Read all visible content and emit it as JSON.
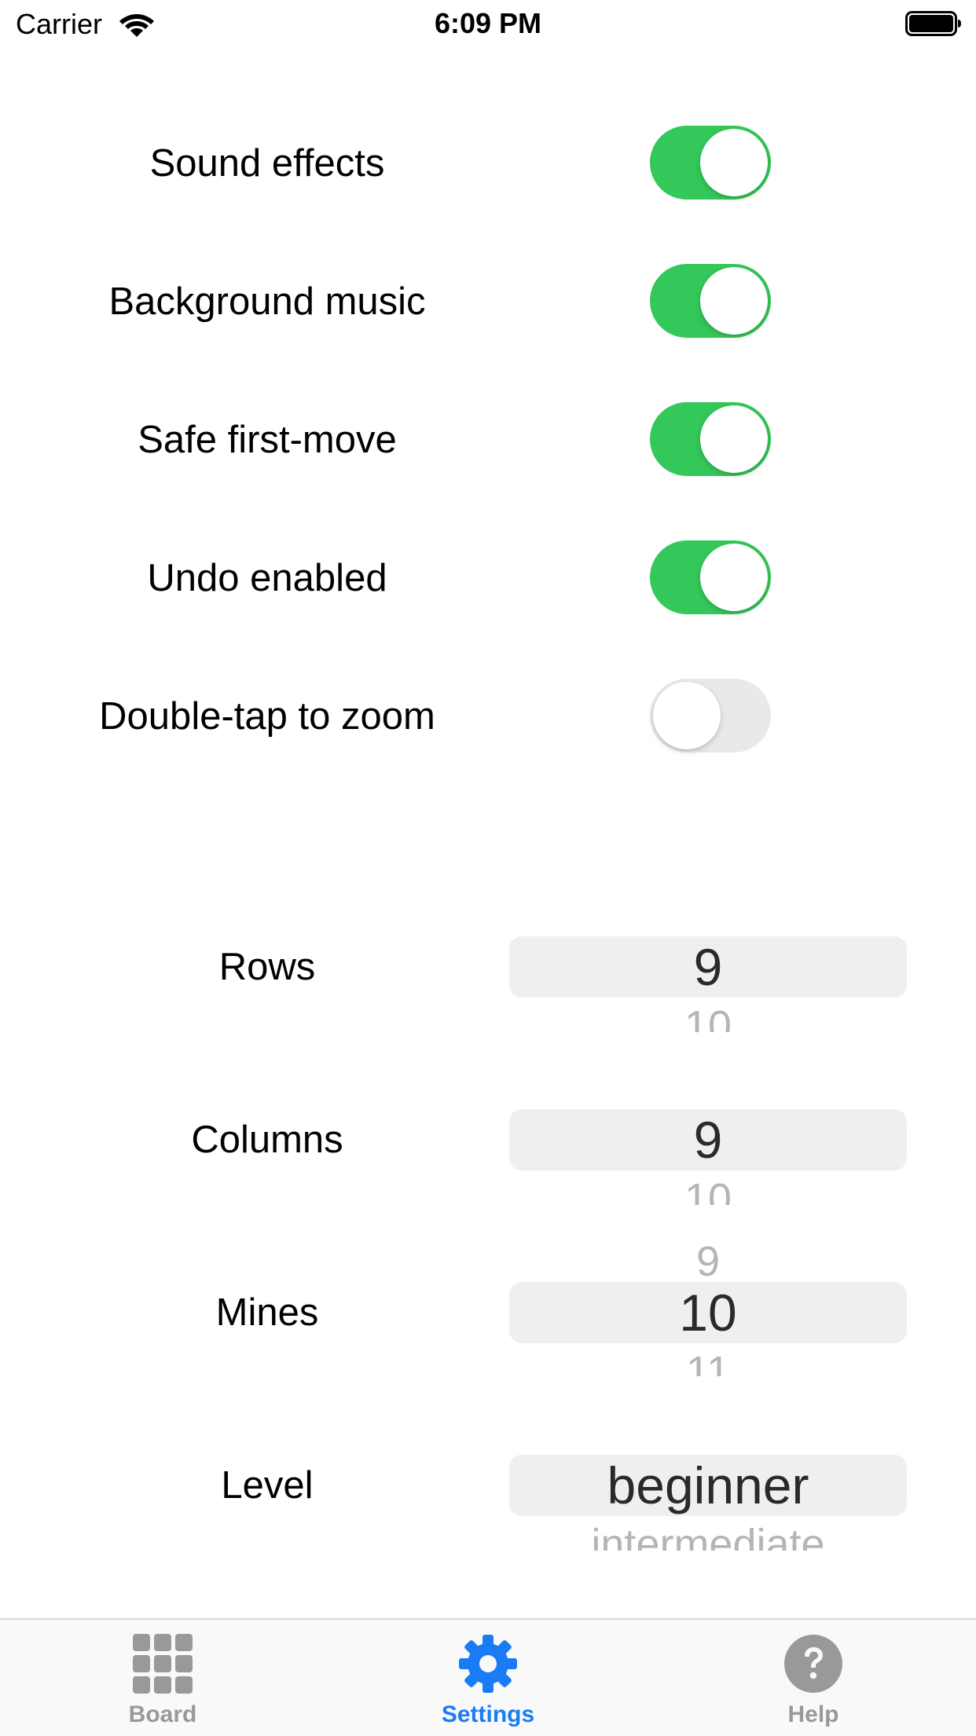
{
  "status_bar": {
    "carrier": "Carrier",
    "time": "6:09 PM"
  },
  "toggles": [
    {
      "label": "Sound effects",
      "on": true
    },
    {
      "label": "Background music",
      "on": true
    },
    {
      "label": "Safe first-move",
      "on": true
    },
    {
      "label": "Undo enabled",
      "on": true
    },
    {
      "label": "Double-tap to zoom",
      "on": false
    }
  ],
  "pickers": {
    "rows": {
      "label": "Rows",
      "above": "",
      "selected": "9",
      "below": "10"
    },
    "columns": {
      "label": "Columns",
      "above": "",
      "selected": "9",
      "below": "10"
    },
    "mines": {
      "label": "Mines",
      "above": "9",
      "selected": "10",
      "below": "11"
    },
    "level": {
      "label": "Level",
      "above": "",
      "selected": "beginner",
      "below": "intermediate"
    }
  },
  "tab_bar": {
    "tabs": [
      {
        "label": "Board",
        "icon": "grid-icon",
        "active": false
      },
      {
        "label": "Settings",
        "icon": "gear-icon",
        "active": true
      },
      {
        "label": "Help",
        "icon": "help-icon",
        "active": false
      }
    ]
  },
  "colors": {
    "switch_on": "#34c759",
    "switch_off": "#e9e9eb",
    "tab_active": "#1a7cf5",
    "tab_inactive": "#999999"
  }
}
